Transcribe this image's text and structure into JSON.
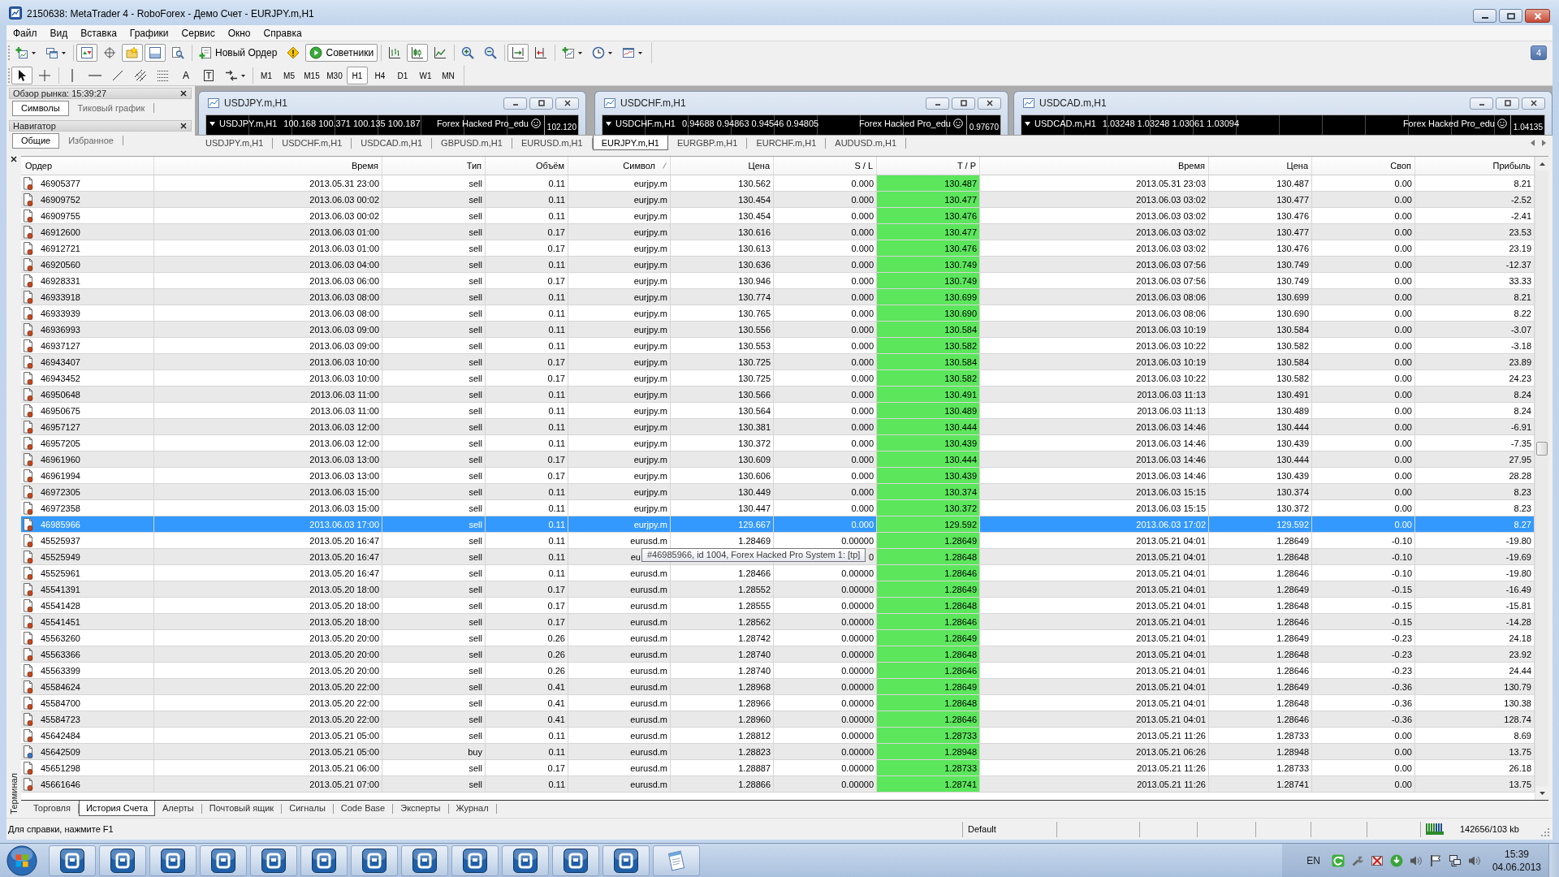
{
  "window": {
    "title": "2150638: MetaTrader 4 - RoboForex - Демо Счет - EURJPY.m,H1"
  },
  "menu": [
    "Файл",
    "Вид",
    "Вставка",
    "Графики",
    "Сервис",
    "Окно",
    "Справка"
  ],
  "toolbar": {
    "groups": [
      [
        {
          "kind": "newchart",
          "on": false,
          "dropdown": true
        },
        {
          "kind": "profiles",
          "on": false,
          "dropdown": true
        }
      ],
      [
        {
          "kind": "watch",
          "on": true
        },
        {
          "kind": "datawindow",
          "on": false
        },
        {
          "kind": "navigator",
          "on": true
        },
        {
          "kind": "terminal",
          "on": true
        },
        {
          "kind": "tester",
          "on": false
        }
      ],
      [
        {
          "kind": "order",
          "label": "Новый Ордер",
          "on": false
        },
        {
          "kind": "editor",
          "on": false
        },
        {
          "kind": "experts",
          "label": "Советники",
          "on": true
        }
      ],
      [
        {
          "kind": "bars",
          "on": false
        },
        {
          "kind": "candles",
          "on": true
        },
        {
          "kind": "line",
          "on": false
        }
      ],
      [
        {
          "kind": "zoomin",
          "on": false
        },
        {
          "kind": "zoomout",
          "on": false
        }
      ],
      [
        {
          "kind": "autoscroll",
          "on": true
        },
        {
          "kind": "shift",
          "on": false
        }
      ],
      [
        {
          "kind": "indicators",
          "on": false,
          "dropdown": true
        },
        {
          "kind": "periods",
          "on": false,
          "dropdown": true
        },
        {
          "kind": "templates",
          "on": false,
          "dropdown": true
        }
      ]
    ]
  },
  "notifications": {
    "count": "4"
  },
  "drawing_toolbar": {
    "groups": [
      [
        {
          "kind": "cursor",
          "on": true
        },
        {
          "kind": "crosshair",
          "on": false
        }
      ],
      [
        {
          "kind": "vline",
          "on": false
        },
        {
          "kind": "hline",
          "on": false
        },
        {
          "kind": "trend",
          "on": false
        },
        {
          "kind": "channel",
          "on": false
        },
        {
          "kind": "fibo",
          "on": false
        },
        {
          "kind": "text",
          "label": "A",
          "on": false
        },
        {
          "kind": "label",
          "label": "T",
          "on": false
        },
        {
          "kind": "arrows",
          "on": false,
          "dropdown": true
        }
      ]
    ],
    "periods": [
      {
        "label": "M1",
        "selected": false
      },
      {
        "label": "M5",
        "selected": false
      },
      {
        "label": "M15",
        "selected": false
      },
      {
        "label": "M30",
        "selected": false
      },
      {
        "label": "H1",
        "selected": true
      },
      {
        "label": "H4",
        "selected": false
      },
      {
        "label": "D1",
        "selected": false
      },
      {
        "label": "W1",
        "selected": false
      },
      {
        "label": "MN",
        "selected": false
      }
    ]
  },
  "market_watch": {
    "title": "Обзор рынка: 15:39:27",
    "tabs": [
      {
        "label": "Символы",
        "selected": true
      },
      {
        "label": "Тиковый график",
        "selected": false
      }
    ]
  },
  "navigator": {
    "title": "Навигатор",
    "tabs": [
      {
        "label": "Общие",
        "selected": true
      },
      {
        "label": "Избранное",
        "selected": false
      }
    ]
  },
  "charts": [
    {
      "title": "USDJPY.m,H1",
      "symbol": "USDJPY.m,H1",
      "quotes": "100.168 100.371 100.135 100.187",
      "expert": "Forex Hacked Pro_edu",
      "price": "102.120"
    },
    {
      "title": "USDCHF.m,H1",
      "symbol": "USDCHF.m,H1",
      "quotes": "0.94688 0.94863 0.94546 0.94805",
      "expert": "Forex Hacked Pro_edu",
      "price": "0.97670"
    },
    {
      "title": "USDCAD.m,H1",
      "symbol": "USDCAD.m,H1",
      "quotes": "1.03248 1.03248 1.03061 1.03094",
      "expert": "Forex Hacked Pro_edu",
      "price": "1.04135"
    }
  ],
  "chart_tabs": [
    {
      "label": "USDJPY.m,H1",
      "selected": false
    },
    {
      "label": "USDCHF.m,H1",
      "selected": false
    },
    {
      "label": "USDCAD.m,H1",
      "selected": false
    },
    {
      "label": "GBPUSD.m,H1",
      "selected": false
    },
    {
      "label": "EURUSD.m,H1",
      "selected": false
    },
    {
      "label": "EURJPY.m,H1",
      "selected": true
    },
    {
      "label": "EURGBP.m,H1",
      "selected": false
    },
    {
      "label": "EURCHF.m,H1",
      "selected": false
    },
    {
      "label": "AUDUSD.m,H1",
      "selected": false
    }
  ],
  "terminal": {
    "label": "Терминал",
    "columns": [
      {
        "label": "Ордер",
        "sorted": false
      },
      {
        "label": "Время",
        "sorted": false
      },
      {
        "label": "Тип",
        "sorted": false
      },
      {
        "label": "Объём",
        "sorted": false
      },
      {
        "label": "Символ",
        "sorted": true
      },
      {
        "label": "Цена",
        "sorted": false
      },
      {
        "label": "S / L",
        "sorted": false
      },
      {
        "label": "T / P",
        "sorted": false
      },
      {
        "label": "Время",
        "sorted": false
      },
      {
        "label": "Цена",
        "sorted": false
      },
      {
        "label": "Своп",
        "sorted": false
      },
      {
        "label": "Прибыль",
        "sorted": false
      }
    ],
    "rows": [
      {
        "kind": "sell",
        "selected": false,
        "cells": [
          "46905377",
          "2013.05.31 23:00",
          "sell",
          "0.11",
          "eurjpy.m",
          "130.562",
          "0.000",
          "130.487",
          "2013.05.31 23:03",
          "130.487",
          "0.00",
          "8.21"
        ]
      },
      {
        "kind": "sell",
        "selected": false,
        "cells": [
          "46909752",
          "2013.06.03 00:02",
          "sell",
          "0.11",
          "eurjpy.m",
          "130.454",
          "0.000",
          "130.477",
          "2013.06.03 03:02",
          "130.477",
          "0.00",
          "-2.52"
        ]
      },
      {
        "kind": "sell",
        "selected": false,
        "cells": [
          "46909755",
          "2013.06.03 00:02",
          "sell",
          "0.11",
          "eurjpy.m",
          "130.454",
          "0.000",
          "130.476",
          "2013.06.03 03:02",
          "130.476",
          "0.00",
          "-2.41"
        ]
      },
      {
        "kind": "sell",
        "selected": false,
        "cells": [
          "46912600",
          "2013.06.03 01:00",
          "sell",
          "0.17",
          "eurjpy.m",
          "130.616",
          "0.000",
          "130.477",
          "2013.06.03 03:02",
          "130.477",
          "0.00",
          "23.53"
        ]
      },
      {
        "kind": "sell",
        "selected": false,
        "cells": [
          "46912721",
          "2013.06.03 01:00",
          "sell",
          "0.17",
          "eurjpy.m",
          "130.613",
          "0.000",
          "130.476",
          "2013.06.03 03:02",
          "130.476",
          "0.00",
          "23.19"
        ]
      },
      {
        "kind": "sell",
        "selected": false,
        "cells": [
          "46920560",
          "2013.06.03 04:00",
          "sell",
          "0.11",
          "eurjpy.m",
          "130.636",
          "0.000",
          "130.749",
          "2013.06.03 07:56",
          "130.749",
          "0.00",
          "-12.37"
        ]
      },
      {
        "kind": "sell",
        "selected": false,
        "cells": [
          "46928331",
          "2013.06.03 06:00",
          "sell",
          "0.17",
          "eurjpy.m",
          "130.946",
          "0.000",
          "130.749",
          "2013.06.03 07:56",
          "130.749",
          "0.00",
          "33.33"
        ]
      },
      {
        "kind": "sell",
        "selected": false,
        "cells": [
          "46933918",
          "2013.06.03 08:00",
          "sell",
          "0.11",
          "eurjpy.m",
          "130.774",
          "0.000",
          "130.699",
          "2013.06.03 08:06",
          "130.699",
          "0.00",
          "8.21"
        ]
      },
      {
        "kind": "sell",
        "selected": false,
        "cells": [
          "46933939",
          "2013.06.03 08:00",
          "sell",
          "0.11",
          "eurjpy.m",
          "130.765",
          "0.000",
          "130.690",
          "2013.06.03 08:06",
          "130.690",
          "0.00",
          "8.22"
        ]
      },
      {
        "kind": "sell",
        "selected": false,
        "cells": [
          "46936993",
          "2013.06.03 09:00",
          "sell",
          "0.11",
          "eurjpy.m",
          "130.556",
          "0.000",
          "130.584",
          "2013.06.03 10:19",
          "130.584",
          "0.00",
          "-3.07"
        ]
      },
      {
        "kind": "sell",
        "selected": false,
        "cells": [
          "46937127",
          "2013.06.03 09:00",
          "sell",
          "0.11",
          "eurjpy.m",
          "130.553",
          "0.000",
          "130.582",
          "2013.06.03 10:22",
          "130.582",
          "0.00",
          "-3.18"
        ]
      },
      {
        "kind": "sell",
        "selected": false,
        "cells": [
          "46943407",
          "2013.06.03 10:00",
          "sell",
          "0.17",
          "eurjpy.m",
          "130.725",
          "0.000",
          "130.584",
          "2013.06.03 10:19",
          "130.584",
          "0.00",
          "23.89"
        ]
      },
      {
        "kind": "sell",
        "selected": false,
        "cells": [
          "46943452",
          "2013.06.03 10:00",
          "sell",
          "0.17",
          "eurjpy.m",
          "130.725",
          "0.000",
          "130.582",
          "2013.06.03 10:22",
          "130.582",
          "0.00",
          "24.23"
        ]
      },
      {
        "kind": "sell",
        "selected": false,
        "cells": [
          "46950648",
          "2013.06.03 11:00",
          "sell",
          "0.11",
          "eurjpy.m",
          "130.566",
          "0.000",
          "130.491",
          "2013.06.03 11:13",
          "130.491",
          "0.00",
          "8.24"
        ]
      },
      {
        "kind": "sell",
        "selected": false,
        "cells": [
          "46950675",
          "2013.06.03 11:00",
          "sell",
          "0.11",
          "eurjpy.m",
          "130.564",
          "0.000",
          "130.489",
          "2013.06.03 11:13",
          "130.489",
          "0.00",
          "8.24"
        ]
      },
      {
        "kind": "sell",
        "selected": false,
        "cells": [
          "46957127",
          "2013.06.03 12:00",
          "sell",
          "0.11",
          "eurjpy.m",
          "130.381",
          "0.000",
          "130.444",
          "2013.06.03 14:46",
          "130.444",
          "0.00",
          "-6.91"
        ]
      },
      {
        "kind": "sell",
        "selected": false,
        "cells": [
          "46957205",
          "2013.06.03 12:00",
          "sell",
          "0.11",
          "eurjpy.m",
          "130.372",
          "0.000",
          "130.439",
          "2013.06.03 14:46",
          "130.439",
          "0.00",
          "-7.35"
        ]
      },
      {
        "kind": "sell",
        "selected": false,
        "cells": [
          "46961960",
          "2013.06.03 13:00",
          "sell",
          "0.17",
          "eurjpy.m",
          "130.609",
          "0.000",
          "130.444",
          "2013.06.03 14:46",
          "130.444",
          "0.00",
          "27.95"
        ]
      },
      {
        "kind": "sell",
        "selected": false,
        "cells": [
          "46961994",
          "2013.06.03 13:00",
          "sell",
          "0.17",
          "eurjpy.m",
          "130.606",
          "0.000",
          "130.439",
          "2013.06.03 14:46",
          "130.439",
          "0.00",
          "28.28"
        ]
      },
      {
        "kind": "sell",
        "selected": false,
        "cells": [
          "46972305",
          "2013.06.03 15:00",
          "sell",
          "0.11",
          "eurjpy.m",
          "130.449",
          "0.000",
          "130.374",
          "2013.06.03 15:15",
          "130.374",
          "0.00",
          "8.23"
        ]
      },
      {
        "kind": "sell",
        "selected": false,
        "cells": [
          "46972358",
          "2013.06.03 15:00",
          "sell",
          "0.11",
          "eurjpy.m",
          "130.447",
          "0.000",
          "130.372",
          "2013.06.03 15:15",
          "130.372",
          "0.00",
          "8.23"
        ]
      },
      {
        "kind": "sell",
        "selected": true,
        "cells": [
          "46985966",
          "2013.06.03 17:00",
          "sell",
          "0.11",
          "eurjpy.m",
          "129.667",
          "0.000",
          "129.592",
          "2013.06.03 17:02",
          "129.592",
          "0.00",
          "8.27"
        ]
      },
      {
        "kind": "sell",
        "selected": false,
        "cells": [
          "45525937",
          "2013.05.20 16:47",
          "sell",
          "0.11",
          "eurusd.m",
          "1.28469",
          "0.00000",
          "1.28649",
          "2013.05.21 04:01",
          "1.28649",
          "-0.10",
          "-19.80"
        ]
      },
      {
        "kind": "sell",
        "selected": false,
        "cells": [
          "45525949",
          "2013.05.20 16:47",
          "sell",
          "0.11",
          "eu",
          null,
          "0",
          "1.28648",
          "2013.05.21 04:01",
          "1.28648",
          "-0.10",
          "-19.69"
        ]
      },
      {
        "kind": "sell",
        "selected": false,
        "cells": [
          "45525961",
          "2013.05.20 16:47",
          "sell",
          "0.11",
          "eurusd.m",
          "1.28466",
          "0.00000",
          "1.28646",
          "2013.05.21 04:01",
          "1.28646",
          "-0.10",
          "-19.80"
        ]
      },
      {
        "kind": "sell",
        "selected": false,
        "cells": [
          "45541391",
          "2013.05.20 18:00",
          "sell",
          "0.17",
          "eurusd.m",
          "1.28552",
          "0.00000",
          "1.28649",
          "2013.05.21 04:01",
          "1.28649",
          "-0.15",
          "-16.49"
        ]
      },
      {
        "kind": "sell",
        "selected": false,
        "cells": [
          "45541428",
          "2013.05.20 18:00",
          "sell",
          "0.17",
          "eurusd.m",
          "1.28555",
          "0.00000",
          "1.28648",
          "2013.05.21 04:01",
          "1.28648",
          "-0.15",
          "-15.81"
        ]
      },
      {
        "kind": "sell",
        "selected": false,
        "cells": [
          "45541451",
          "2013.05.20 18:00",
          "sell",
          "0.17",
          "eurusd.m",
          "1.28562",
          "0.00000",
          "1.28646",
          "2013.05.21 04:01",
          "1.28646",
          "-0.15",
          "-14.28"
        ]
      },
      {
        "kind": "sell",
        "selected": false,
        "cells": [
          "45563260",
          "2013.05.20 20:00",
          "sell",
          "0.26",
          "eurusd.m",
          "1.28742",
          "0.00000",
          "1.28649",
          "2013.05.21 04:01",
          "1.28649",
          "-0.23",
          "24.18"
        ]
      },
      {
        "kind": "sell",
        "selected": false,
        "cells": [
          "45563366",
          "2013.05.20 20:00",
          "sell",
          "0.26",
          "eurusd.m",
          "1.28740",
          "0.00000",
          "1.28648",
          "2013.05.21 04:01",
          "1.28648",
          "-0.23",
          "23.92"
        ]
      },
      {
        "kind": "sell",
        "selected": false,
        "cells": [
          "45563399",
          "2013.05.20 20:00",
          "sell",
          "0.26",
          "eurusd.m",
          "1.28740",
          "0.00000",
          "1.28646",
          "2013.05.21 04:01",
          "1.28646",
          "-0.23",
          "24.44"
        ]
      },
      {
        "kind": "sell",
        "selected": false,
        "cells": [
          "45584624",
          "2013.05.20 22:00",
          "sell",
          "0.41",
          "eurusd.m",
          "1.28968",
          "0.00000",
          "1.28649",
          "2013.05.21 04:01",
          "1.28649",
          "-0.36",
          "130.79"
        ]
      },
      {
        "kind": "sell",
        "selected": false,
        "cells": [
          "45584700",
          "2013.05.20 22:00",
          "sell",
          "0.41",
          "eurusd.m",
          "1.28966",
          "0.00000",
          "1.28648",
          "2013.05.21 04:01",
          "1.28648",
          "-0.36",
          "130.38"
        ]
      },
      {
        "kind": "sell",
        "selected": false,
        "cells": [
          "45584723",
          "2013.05.20 22:00",
          "sell",
          "0.41",
          "eurusd.m",
          "1.28960",
          "0.00000",
          "1.28646",
          "2013.05.21 04:01",
          "1.28646",
          "-0.36",
          "128.74"
        ]
      },
      {
        "kind": "sell",
        "selected": false,
        "cells": [
          "45642484",
          "2013.05.21 05:00",
          "sell",
          "0.11",
          "eurusd.m",
          "1.28812",
          "0.00000",
          "1.28733",
          "2013.05.21 11:26",
          "1.28733",
          "0.00",
          "8.69"
        ]
      },
      {
        "kind": "buy",
        "selected": false,
        "cells": [
          "45642509",
          "2013.05.21 05:00",
          "buy",
          "0.11",
          "eurusd.m",
          "1.28823",
          "0.00000",
          "1.28948",
          "2013.05.21 06:26",
          "1.28948",
          "0.00",
          "13.75"
        ]
      },
      {
        "kind": "sell",
        "selected": false,
        "cells": [
          "45651298",
          "2013.05.21 06:00",
          "sell",
          "0.17",
          "eurusd.m",
          "1.28887",
          "0.00000",
          "1.28733",
          "2013.05.21 11:26",
          "1.28733",
          "0.00",
          "26.18"
        ]
      },
      {
        "kind": "sell",
        "selected": false,
        "cells": [
          "45661646",
          "2013.05.21 07:00",
          "sell",
          "0.11",
          "eurusd.m",
          "1.28866",
          "0.00000",
          "1.28741",
          "2013.05.21 11:26",
          "1.28741",
          "0.00",
          "13.75"
        ]
      }
    ],
    "tooltip": "#46985966, id 1004, Forex Hacked Pro System 1: [tp]",
    "tabs": [
      {
        "label": "Торговля",
        "selected": false
      },
      {
        "label": "История Счета",
        "selected": true
      },
      {
        "label": "Алерты",
        "selected": false
      },
      {
        "label": "Почтовый ящик",
        "selected": false
      },
      {
        "label": "Сигналы",
        "selected": false
      },
      {
        "label": "Code Base",
        "selected": false
      },
      {
        "label": "Эксперты",
        "selected": false
      },
      {
        "label": "Журнал",
        "selected": false
      }
    ]
  },
  "status_bar": {
    "help": "Для справки, нажмите F1",
    "profile": "Default",
    "traffic": "142656/103 kb"
  },
  "taskbar": {
    "buttons": [
      {
        "kind": "terminal"
      },
      {
        "kind": "terminal"
      },
      {
        "kind": "terminal"
      },
      {
        "kind": "terminal"
      },
      {
        "kind": "terminal"
      },
      {
        "kind": "terminal"
      },
      {
        "kind": "terminal"
      },
      {
        "kind": "terminal"
      },
      {
        "kind": "terminal"
      },
      {
        "kind": "terminal"
      },
      {
        "kind": "terminal"
      },
      {
        "kind": "terminal"
      },
      {
        "kind": "notepad"
      }
    ],
    "language": "EN",
    "time": "15:39",
    "date": "04.06.2013"
  }
}
